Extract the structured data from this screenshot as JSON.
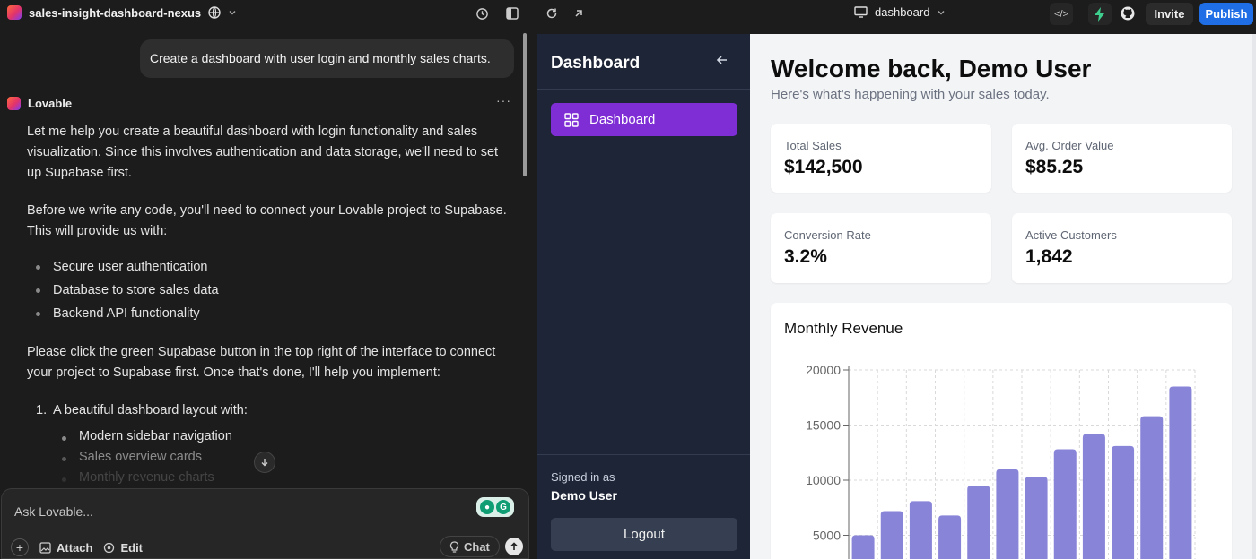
{
  "topbar": {
    "project_name": "sales-insight-dashboard-nexus",
    "route": "dashboard",
    "invite_label": "Invite",
    "publish_label": "Publish"
  },
  "chat": {
    "user_message": "Create a dashboard with user login and monthly sales charts.",
    "assistant_name": "Lovable",
    "para1": "Let me help you create a beautiful dashboard with login functionality and sales visualization. Since this involves authentication and data storage, we'll need to set up Supabase first.",
    "para2": "Before we write any code, you'll need to connect your Lovable project to Supabase. This will provide us with:",
    "bullets": [
      "Secure user authentication",
      "Database to store sales data",
      "Backend API functionality"
    ],
    "para3": "Please click the green Supabase button in the top right of the interface to connect your project to Supabase first. Once that's done, I'll help you implement:",
    "numbered": [
      {
        "num": "1.",
        "text": "A beautiful dashboard layout with:"
      }
    ],
    "sub_bullets": [
      "Modern sidebar navigation",
      "Sales overview cards",
      "Monthly revenue charts"
    ],
    "composer_placeholder": "Ask Lovable...",
    "attach_label": "Attach",
    "edit_label": "Edit",
    "chat_label": "Chat"
  },
  "preview": {
    "sidebar_title": "Dashboard",
    "nav_item": "Dashboard",
    "signed_in_label": "Signed in as",
    "signed_in_user": "Demo User",
    "logout_label": "Logout",
    "welcome": "Welcome back, Demo User",
    "welcome_sub": "Here's what's happening with your sales today.",
    "cards": [
      {
        "label": "Total Sales",
        "value": "$142,500"
      },
      {
        "label": "Avg. Order Value",
        "value": "$85.25"
      },
      {
        "label": "Conversion Rate",
        "value": "3.2%"
      },
      {
        "label": "Active Customers",
        "value": "1,842"
      }
    ],
    "chart_title": "Monthly Revenue"
  },
  "colors": {
    "accent_purple": "#7e2ed4",
    "bar_fill": "#8884d8",
    "publish_blue": "#1f6ee6",
    "sidebar_bg": "#1e2536"
  },
  "chart_data": {
    "type": "bar",
    "title": "Monthly Revenue",
    "xlabel": "",
    "ylabel": "",
    "ylim": [
      0,
      20000
    ],
    "yticks": [
      20000,
      15000,
      10000,
      5000
    ],
    "values": [
      5000,
      7200,
      8100,
      6800,
      9500,
      11000,
      10300,
      12800,
      14200,
      13100,
      15800,
      18500
    ],
    "grid": true
  }
}
